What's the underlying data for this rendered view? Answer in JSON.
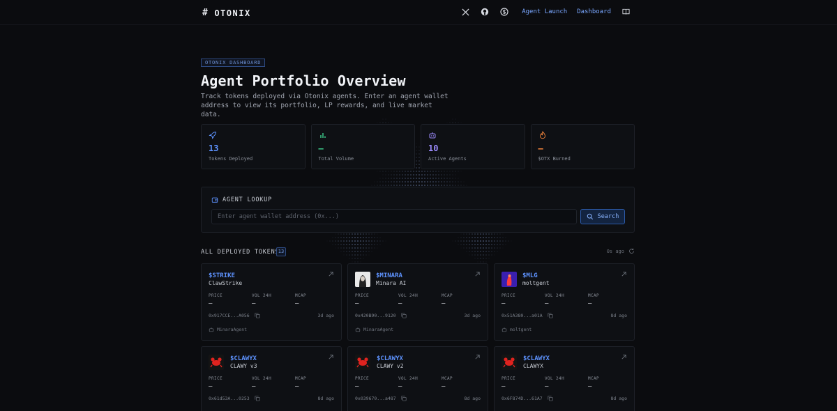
{
  "nav": {
    "brand": "OTONIX",
    "brand_mark": "#",
    "icons": [
      "x-icon",
      "github-icon",
      "dollar-icon"
    ],
    "links": [
      {
        "label": "Agent Launch"
      },
      {
        "label": "Dashboard"
      }
    ],
    "docs_icon": "book-icon"
  },
  "hero": {
    "badge": "OTONIX DASHBOARD",
    "title": "Agent Portfolio Overview",
    "subtitle": "Track tokens deployed via Otonix agents. Enter an agent wallet address to view its portfolio, LP rewards, and live market data."
  },
  "stats": [
    {
      "icon": "rocket-icon",
      "value": "13",
      "label": "Tokens Deployed",
      "color": "#5e93ff"
    },
    {
      "icon": "bar-chart-icon",
      "value": "—",
      "label": "Total Volume",
      "color": "#3ecf8e"
    },
    {
      "icon": "robot-icon",
      "value": "10",
      "label": "Active Agents",
      "color": "#9d8cff"
    },
    {
      "icon": "flame-icon",
      "value": "—",
      "label": "$OTX Burned",
      "color": "#ff8a3d"
    }
  ],
  "lookup": {
    "title": "AGENT LOOKUP",
    "placeholder": "Enter agent wallet address (0x...)",
    "button": "Search"
  },
  "tokens_section": {
    "title": "ALL DEPLOYED TOKENS",
    "count": "13",
    "updated": "0s ago"
  },
  "metric_labels": {
    "price": "PRICE",
    "vol": "VOL 24H",
    "mcap": "MCAP"
  },
  "tokens": [
    {
      "ticker": "$STRIKE",
      "name": "ClawStrike",
      "image": "none",
      "price": "—",
      "vol": "—",
      "mcap": "—",
      "address": "0x917CCE...A056",
      "age": "3d ago",
      "agent": "MinaraAgent"
    },
    {
      "ticker": "$MINARA",
      "name": "Minara AI",
      "image": "portrait",
      "price": "—",
      "vol": "—",
      "mcap": "—",
      "address": "0x420B90...9120",
      "age": "3d ago",
      "agent": "MinaraAgent"
    },
    {
      "ticker": "$MLG",
      "name": "moltgent",
      "image": "figure",
      "price": "—",
      "vol": "—",
      "mcap": "—",
      "address": "0x51A380...a01A",
      "age": "8d ago",
      "agent": "moltgent"
    },
    {
      "ticker": "$CLAWYX",
      "name": "CLAWY v3",
      "image": "crab",
      "price": "—",
      "vol": "—",
      "mcap": "—",
      "address": "0x61d53A...0253",
      "age": "8d ago",
      "agent": ""
    },
    {
      "ticker": "$CLAWYX",
      "name": "CLAWY v2",
      "image": "crab",
      "price": "—",
      "vol": "—",
      "mcap": "—",
      "address": "0x039670...a487",
      "age": "8d ago",
      "agent": ""
    },
    {
      "ticker": "$CLAWYX",
      "name": "CLAWYX",
      "image": "crab",
      "price": "—",
      "vol": "—",
      "mcap": "—",
      "address": "0x6F874D...61A7",
      "age": "8d ago",
      "agent": ""
    }
  ]
}
